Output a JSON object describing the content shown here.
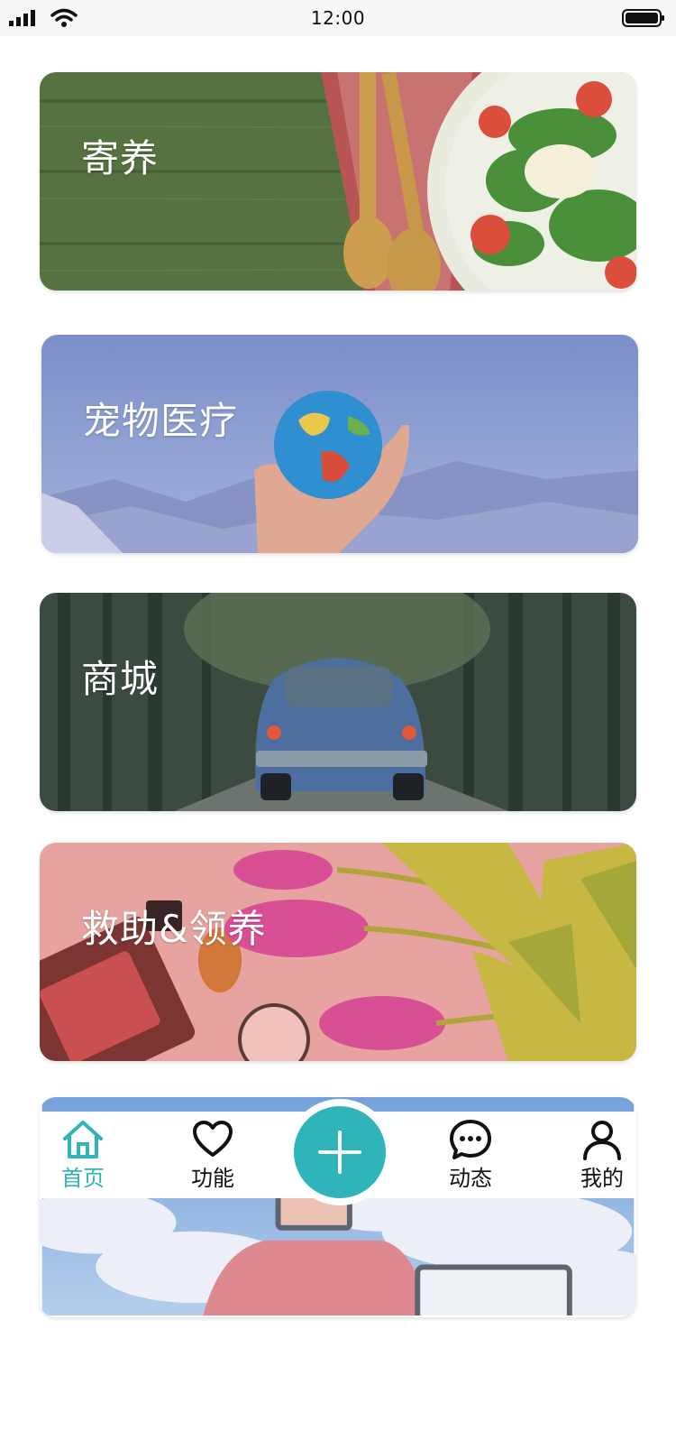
{
  "status_bar": {
    "time": "12:00"
  },
  "cards": [
    {
      "label": "寄养"
    },
    {
      "label": "宠物医疗"
    },
    {
      "label": "商城"
    },
    {
      "label": "救助&领养"
    }
  ],
  "tab_bar": {
    "home": {
      "label": "首页",
      "icon": "home-icon"
    },
    "functions": {
      "label": "功能",
      "icon": "heart-icon"
    },
    "add": {
      "icon": "plus-icon"
    },
    "feed": {
      "label": "动态",
      "icon": "chat-bubble-icon"
    },
    "mine": {
      "label": "我的",
      "icon": "user-icon"
    }
  },
  "colors": {
    "accent": "#2fb4ba"
  }
}
